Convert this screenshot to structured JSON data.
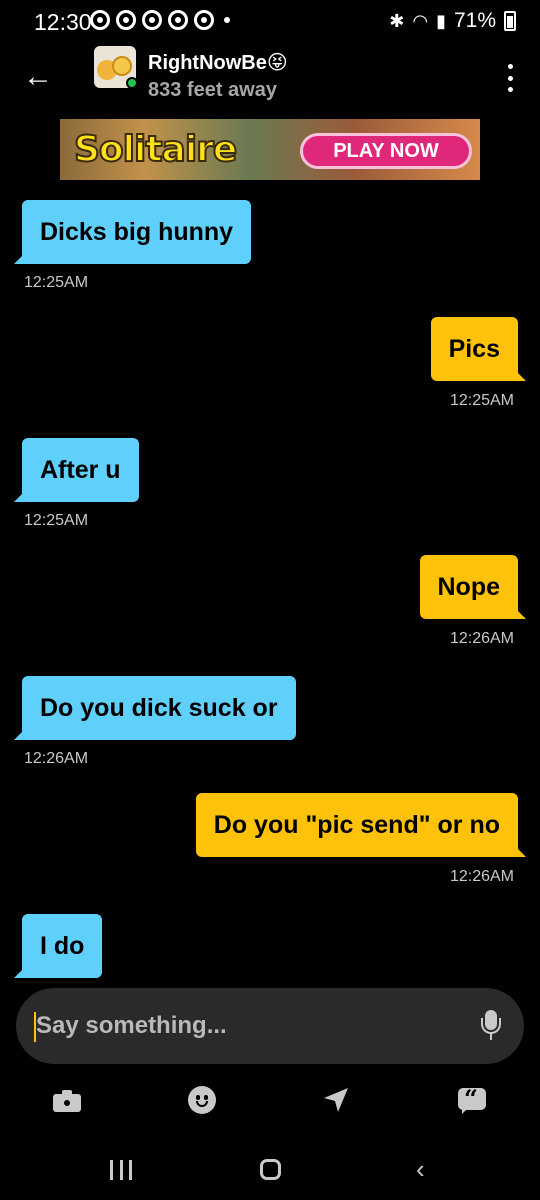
{
  "status_bar": {
    "time": "12:30",
    "battery": "71%",
    "icons": [
      "chrome-icon",
      "chrome-icon",
      "chrome-icon",
      "chrome-icon",
      "chrome-icon",
      "bluetooth-icon",
      "wifi-icon",
      "signal-icon",
      "battery-icon"
    ]
  },
  "header": {
    "name": "RightNowBe😝",
    "distance": "833 feet away",
    "online": true
  },
  "ad": {
    "title": "Solitaire",
    "cta": "PLAY NOW"
  },
  "messages": [
    {
      "direction": "in",
      "text": "Dicks big hunny",
      "time": "12:25AM"
    },
    {
      "direction": "out",
      "text": "Pics",
      "time": "12:25AM"
    },
    {
      "direction": "in",
      "text": "After u",
      "time": "12:25AM"
    },
    {
      "direction": "out",
      "text": "Nope",
      "time": "12:26AM"
    },
    {
      "direction": "in",
      "text": "Do you dick suck or",
      "time": "12:26AM"
    },
    {
      "direction": "out",
      "text": "Do you \"pic send\" or no",
      "time": "12:26AM"
    },
    {
      "direction": "in",
      "text": "I do",
      "time": ""
    }
  ],
  "composer": {
    "placeholder": "Say something...",
    "value": ""
  },
  "actions": [
    "camera-icon",
    "emoji-icon",
    "location-icon",
    "saved-phrases-icon"
  ],
  "colors": {
    "incoming_bubble": "#5fcffb",
    "outgoing_bubble": "#ffc20a",
    "background": "#000000",
    "online": "#23c552"
  }
}
